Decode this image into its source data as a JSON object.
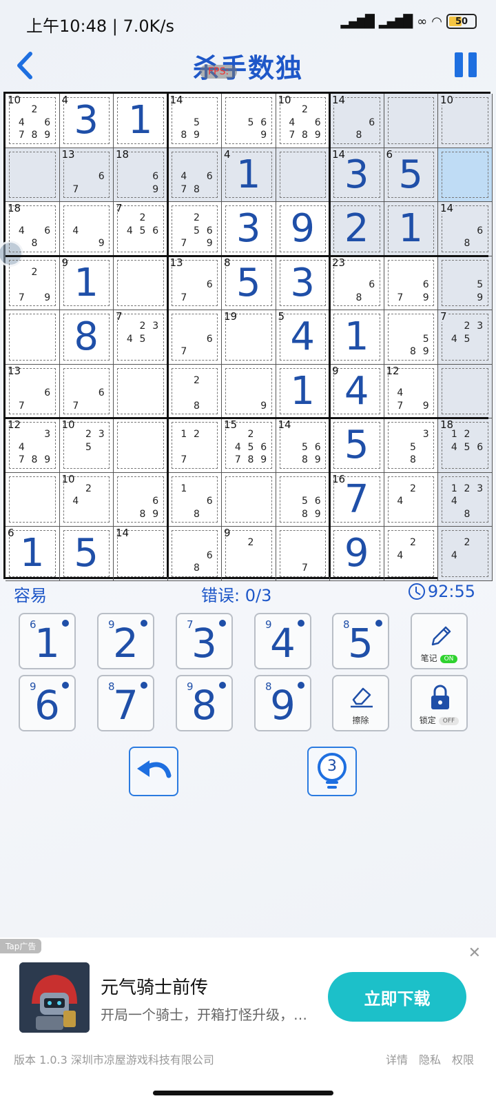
{
  "status_bar": {
    "time": "上午10:48 | 7.0K/s",
    "battery": "50",
    "signal1": "HD",
    "signal2": "HD"
  },
  "header": {
    "title": "杀手数独",
    "fps": "FPS:"
  },
  "board": {
    "cells": [
      [
        "10",
        "4",
        "",
        "14",
        "",
        "10",
        "14",
        "",
        "10"
      ],
      [
        "",
        "13",
        "18",
        "",
        "4",
        "",
        "14",
        "6",
        ""
      ],
      [
        "18",
        "",
        "7",
        "",
        "",
        "",
        "",
        "",
        "14"
      ],
      [
        "",
        "9",
        "",
        "13",
        "8",
        "",
        "23",
        "",
        ""
      ],
      [
        "",
        "",
        "7",
        "",
        "19",
        "5",
        "",
        "",
        "7"
      ],
      [
        "13",
        "",
        "",
        "",
        "",
        "",
        "9",
        "12",
        ""
      ],
      [
        "12",
        "10",
        "",
        "",
        "15",
        "14",
        "",
        "",
        "18"
      ],
      [
        "",
        "10",
        "",
        "",
        "",
        "",
        "16",
        "",
        ""
      ],
      [
        "6",
        "",
        "14",
        "",
        "9",
        "",
        "",
        "",
        ""
      ]
    ],
    "values": [
      [
        "",
        "3",
        "1",
        "",
        "",
        "",
        "",
        "",
        ""
      ],
      [
        "",
        "",
        "",
        "",
        "1",
        "",
        "3",
        "5",
        ""
      ],
      [
        "",
        "",
        "",
        "",
        "3",
        "9",
        "2",
        "1",
        ""
      ],
      [
        "",
        "1",
        "",
        "",
        "5",
        "3",
        "",
        "",
        ""
      ],
      [
        "",
        "8",
        "",
        "",
        "",
        "4",
        "1",
        "",
        ""
      ],
      [
        "",
        "",
        "",
        "",
        "",
        "1",
        "4",
        "",
        ""
      ],
      [
        "",
        "",
        "",
        "",
        "",
        "",
        "5",
        "",
        ""
      ],
      [
        "",
        "",
        "",
        "",
        "",
        "",
        "7",
        "",
        ""
      ],
      [
        "1",
        "5",
        "",
        "",
        "",
        "",
        "9",
        "",
        ""
      ]
    ],
    "notes": [
      [
        [
          "",
          "2",
          "",
          "4",
          "",
          "6",
          "7",
          "8",
          "9"
        ],
        [],
        [],
        [
          "",
          "",
          "",
          "",
          "5",
          "",
          "8",
          "9",
          ""
        ],
        [
          "",
          "",
          "",
          "",
          "5",
          "6",
          "",
          "",
          "9"
        ],
        [
          "",
          "2",
          "",
          "4",
          "",
          "6",
          "7",
          "8",
          "9"
        ],
        [
          "",
          "",
          "",
          "",
          "",
          "6",
          "",
          "8",
          ""
        ],
        [],
        []
      ],
      [
        [],
        [
          "",
          "",
          "",
          "",
          "",
          "6",
          "7",
          "",
          ""
        ],
        [
          "",
          "",
          "",
          "",
          "",
          "6",
          "",
          "",
          "9"
        ],
        [
          "",
          "",
          "",
          "4",
          "",
          "6",
          "7",
          "8",
          ""
        ],
        [],
        [],
        [],
        [],
        []
      ],
      [
        [
          "",
          "",
          "",
          "4",
          "",
          "6",
          "",
          "8",
          ""
        ],
        [
          "",
          "",
          "",
          "4",
          "",
          "",
          "",
          "",
          "9"
        ],
        [
          "",
          "2",
          "",
          "4",
          "5",
          "6",
          "",
          "",
          ""
        ],
        [
          "",
          "2",
          "",
          "",
          "5",
          "6",
          "7",
          "",
          "9"
        ],
        [],
        [],
        [],
        [],
        [
          "",
          "",
          "",
          "",
          "",
          "6",
          "",
          "8",
          ""
        ]
      ],
      [
        [
          "",
          "2",
          "",
          "",
          "",
          "",
          "7",
          "",
          "9"
        ],
        [],
        [],
        [
          "",
          "",
          "",
          "",
          "",
          "6",
          "7",
          "",
          ""
        ],
        [],
        [],
        [
          "",
          "",
          "",
          "",
          "",
          "6",
          "",
          "8",
          ""
        ],
        [
          "",
          "",
          "",
          "",
          "",
          "6",
          "7",
          "",
          "9"
        ],
        [
          "",
          "",
          "",
          "",
          "",
          "5",
          "",
          "",
          "9"
        ]
      ],
      [
        [],
        [],
        [
          "",
          "2",
          "3",
          "4",
          "5",
          "",
          "",
          "",
          ""
        ],
        [
          "",
          "",
          "",
          "",
          "",
          "6",
          "7",
          "",
          ""
        ],
        [],
        [],
        [],
        [
          "",
          "",
          "",
          "",
          "",
          "5",
          "",
          "8",
          "9"
        ],
        [
          "",
          "2",
          "3",
          "4",
          "5",
          "",
          "",
          "",
          ""
        ]
      ],
      [
        [
          "",
          "",
          "",
          "",
          "",
          "6",
          "7",
          "",
          ""
        ],
        [
          "",
          "",
          "",
          "",
          "",
          "6",
          "7",
          "",
          ""
        ],
        [],
        [
          "",
          "2",
          "",
          "",
          "",
          "",
          "",
          "8",
          ""
        ],
        [
          "",
          "",
          "",
          "",
          "",
          "",
          "",
          "",
          "9"
        ],
        [],
        [],
        [
          "",
          "",
          "",
          "4",
          "",
          "",
          "7",
          "",
          "9"
        ],
        []
      ],
      [
        [
          "",
          "",
          "3",
          "4",
          "",
          "",
          "7",
          "8",
          "9"
        ],
        [
          "",
          "2",
          "3",
          "",
          "5",
          "",
          "",
          "",
          ""
        ],
        [],
        [
          "1",
          "2",
          "",
          "",
          "",
          "",
          "7",
          "",
          ""
        ],
        [
          "",
          "2",
          "",
          "4",
          "5",
          "6",
          "7",
          "8",
          "9"
        ],
        [
          "",
          "",
          "",
          "",
          "5",
          "6",
          "",
          "8",
          "9"
        ],
        [],
        [
          "",
          "",
          "3",
          "",
          "5",
          "",
          "",
          "8",
          ""
        ],
        [
          "1",
          "2",
          "",
          "4",
          "5",
          "6",
          "",
          "",
          ""
        ]
      ],
      [
        [],
        [
          "",
          "2",
          "",
          "4",
          "",
          "",
          "",
          "",
          ""
        ],
        [
          "",
          "",
          "",
          "",
          "",
          "6",
          "",
          "8",
          "9"
        ],
        [
          "1",
          "",
          "",
          "",
          "",
          "6",
          "",
          "8",
          ""
        ],
        [],
        [
          "",
          "",
          "",
          "",
          "5",
          "6",
          "",
          "8",
          "9"
        ],
        [],
        [
          "",
          "2",
          "",
          "4",
          "",
          "",
          "",
          "",
          ""
        ],
        [
          "1",
          "2",
          "3",
          "4",
          "",
          "",
          "",
          "8",
          ""
        ]
      ],
      [
        [],
        [],
        [],
        [
          "",
          "",
          "",
          "",
          "",
          "6",
          "",
          "8",
          ""
        ],
        [
          "",
          "2",
          "",
          "",
          "",
          "",
          "",
          "",
          ""
        ],
        [
          "",
          "",
          "",
          "",
          "",
          "",
          "",
          "7",
          ""
        ],
        [],
        [
          "",
          "2",
          "",
          "4",
          "",
          "",
          "",
          "",
          ""
        ],
        [
          "",
          "2",
          "",
          "4",
          "",
          "",
          "",
          "",
          ""
        ]
      ]
    ]
  },
  "info": {
    "difficulty": "容易",
    "errors": "错误: 0/3",
    "timer": "92:55"
  },
  "keypad": {
    "keys": [
      {
        "num": "1",
        "count": "6"
      },
      {
        "num": "2",
        "count": "9"
      },
      {
        "num": "3",
        "count": "7"
      },
      {
        "num": "4",
        "count": "9"
      },
      {
        "num": "5",
        "count": "8"
      },
      {
        "num": "6",
        "count": "9"
      },
      {
        "num": "7",
        "count": "8"
      },
      {
        "num": "8",
        "count": "9"
      },
      {
        "num": "9",
        "count": "8"
      }
    ],
    "note_label": "笔记",
    "note_state": "ON",
    "erase_label": "擦除",
    "lock_label": "锁定",
    "lock_state": "OFF"
  },
  "actions": {
    "hint_count": "3"
  },
  "ad": {
    "tag": "Tap广告",
    "title": "元气骑士前传",
    "desc": "开局一个骑士，开箱打怪升级，…",
    "cta": "立即下载"
  },
  "footer": {
    "version": "版本 1.0.3   深圳市凉屋游戏科技有限公司",
    "details": "详情",
    "privacy": "隐私",
    "permissions": "权限"
  },
  "colors": {
    "accent": "#1e57c8",
    "digit": "#1f4fa8",
    "shaded": "#e1e6ee",
    "selected": "#bfdcf5",
    "cta": "#1cc0c9"
  }
}
